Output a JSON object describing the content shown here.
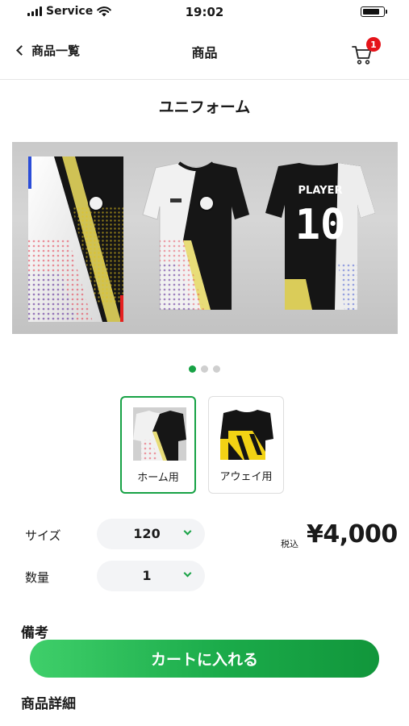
{
  "status_bar": {
    "carrier": "Service",
    "time": "19:02"
  },
  "nav": {
    "back_label": "商品一覧",
    "title": "商品",
    "cart_count": "1"
  },
  "product": {
    "name": "ユニフォーム",
    "jersey_print": {
      "name": "PLAYER",
      "number": "10"
    },
    "carousel": {
      "total": 3,
      "active_index": 0
    },
    "variants": [
      {
        "label": "ホーム用",
        "selected": true
      },
      {
        "label": "アウェイ用",
        "selected": false
      }
    ],
    "options": {
      "size_label": "サイズ",
      "size_value": "120",
      "qty_label": "数量",
      "qty_value": "1"
    },
    "tax_label": "税込",
    "price": "¥4,000",
    "notes_heading": "備考",
    "add_to_cart": "カートに入れる",
    "details_heading": "商品詳細"
  },
  "colors": {
    "accent": "#17a245",
    "badge": "#e5141a"
  }
}
